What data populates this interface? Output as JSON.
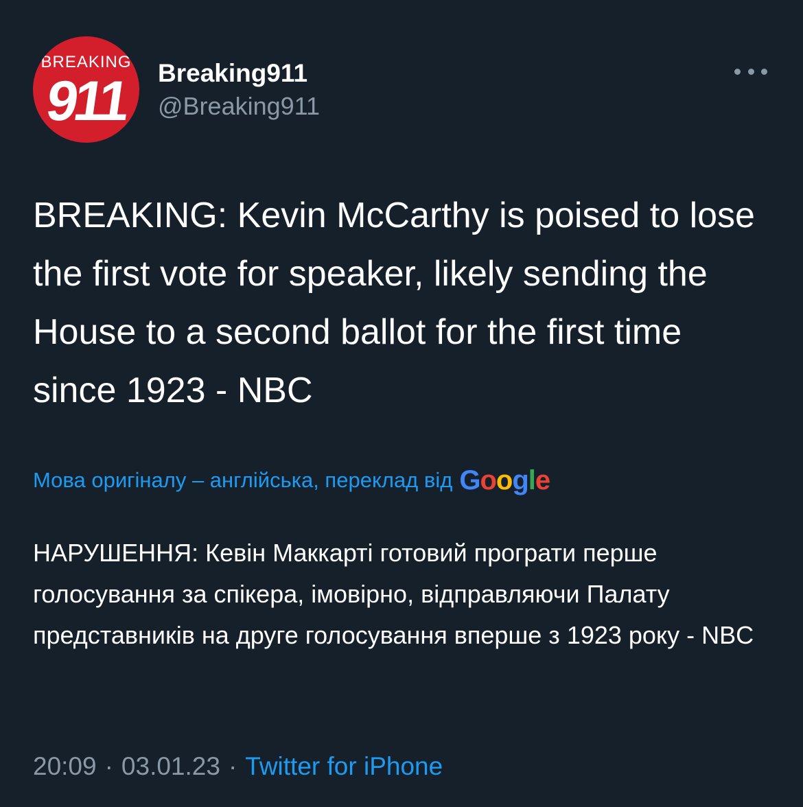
{
  "author": {
    "display_name": "Breaking911",
    "handle": "@Breaking911",
    "avatar_logo_top": "BREAKING",
    "avatar_logo_number": "911",
    "avatar_color": "#d31f2c"
  },
  "tweet": {
    "text": "BREAKING: Kevin McCarthy is poised to lose the first vote for speaker, likely sending the House to a second ballot for the first time since 1923 - NBC"
  },
  "translation": {
    "label": "Мова оригіналу – англійська, переклад від",
    "provider": "Google",
    "text": "НАРУШЕННЯ: Кевін Маккарті готовий програти перше голосування за спікера, імовірно, відправляючи Палату представників на друге голосування вперше з 1923 року - NBC"
  },
  "footer": {
    "time": "20:09",
    "date": "03.01.23",
    "separator": "·",
    "source": "Twitter for iPhone"
  },
  "icons": {
    "more": "more-horizontal-icon"
  },
  "colors": {
    "background": "#15202b",
    "accent": "#1d9bf0",
    "muted": "#8b98a5"
  }
}
